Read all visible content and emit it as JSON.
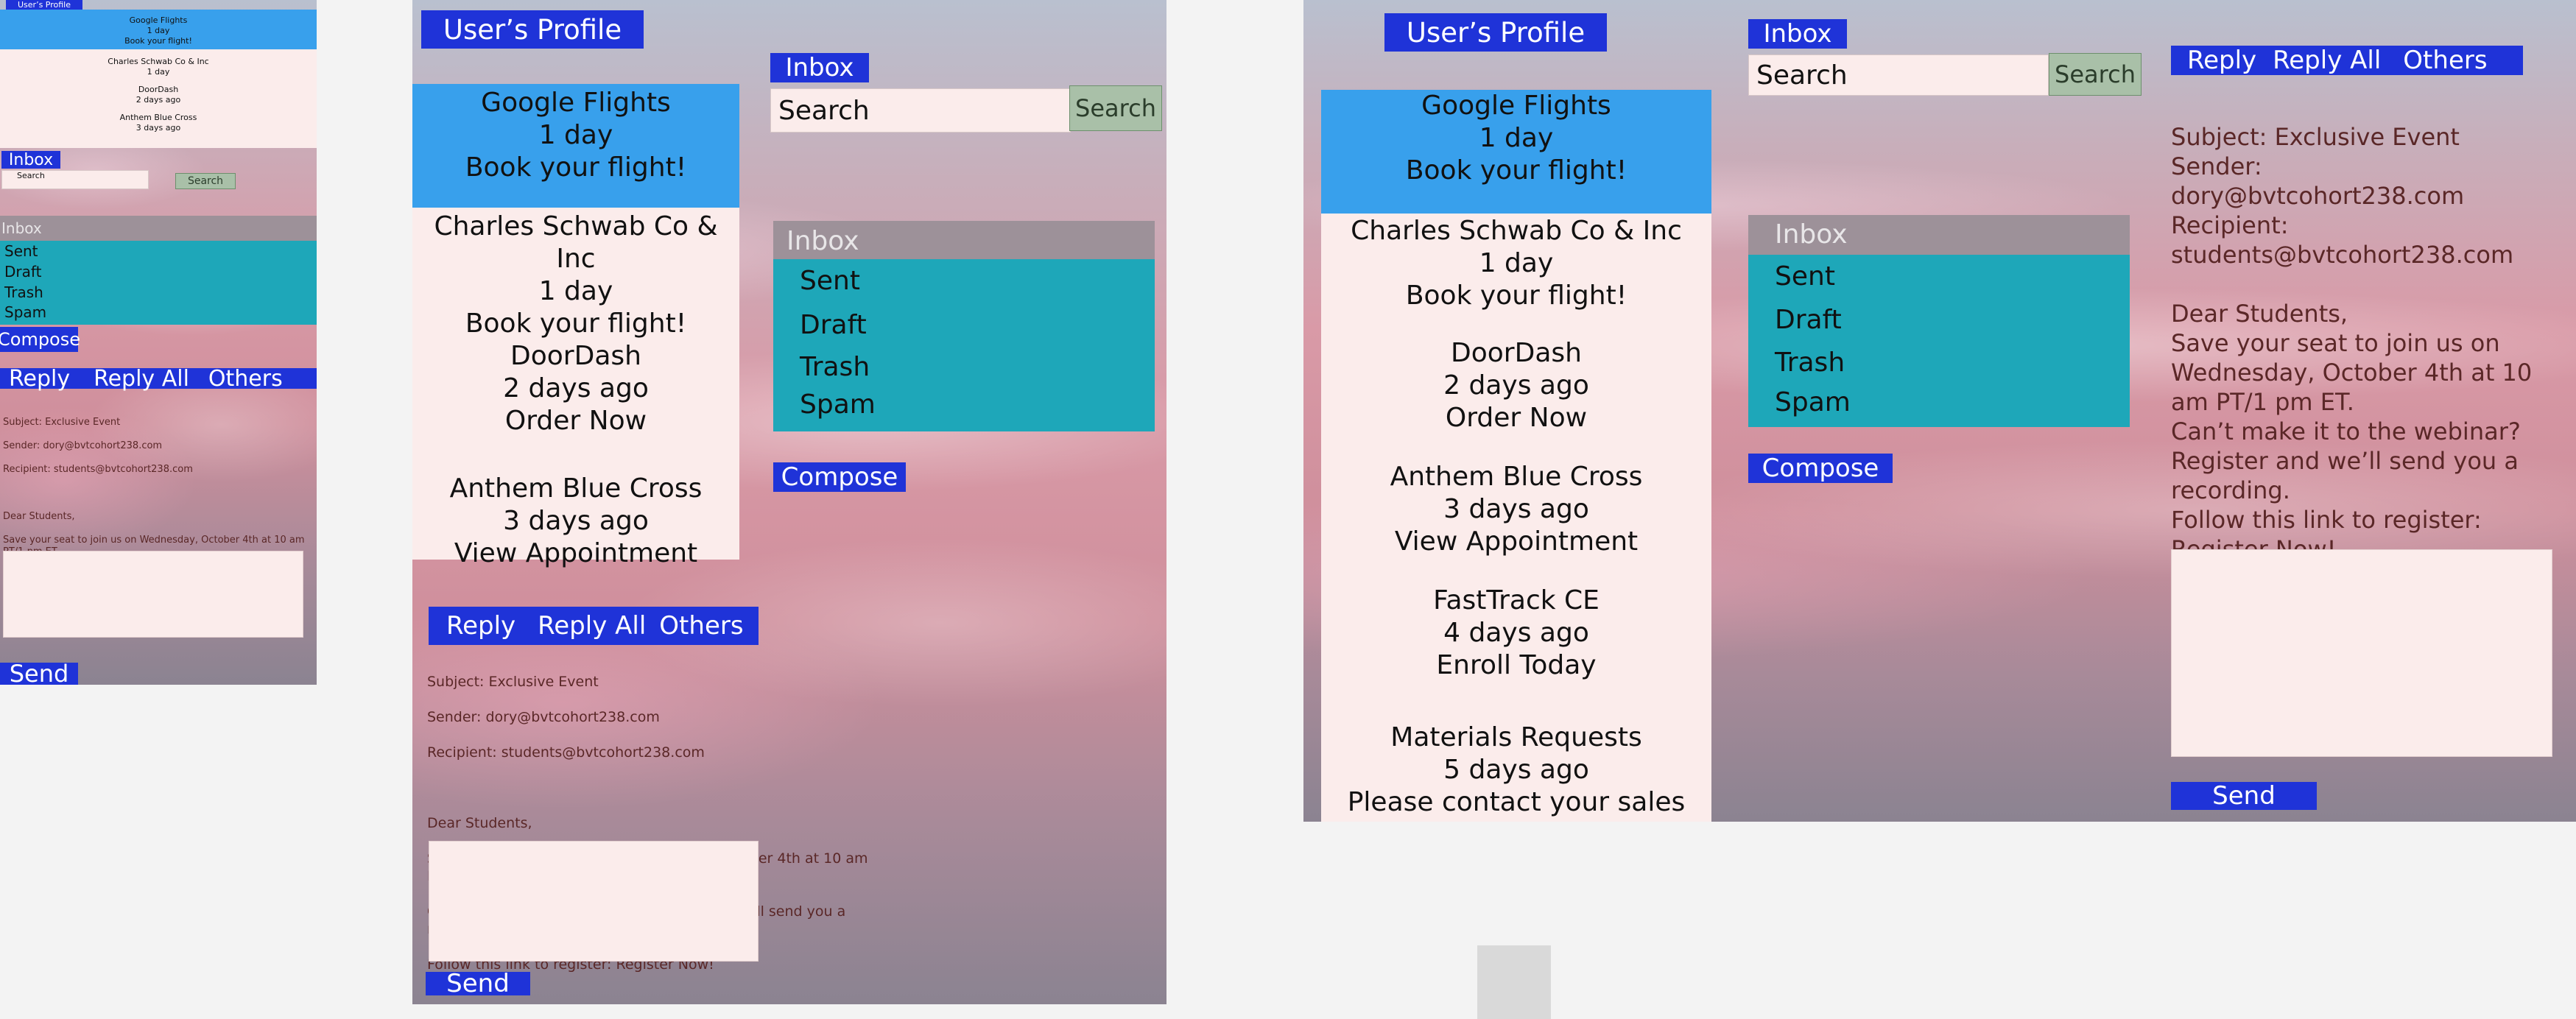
{
  "profile_label": "User’s Profile",
  "inbox_label": "Inbox",
  "search": {
    "placeholder": "Search",
    "button": "Search"
  },
  "emails": [
    {
      "sender": "Google Flights",
      "time": "1 day",
      "action": "Book your flight!"
    },
    {
      "sender": "Charles Schwab Co & Inc",
      "time": "1 day",
      "action": "Book your flight!"
    },
    {
      "sender": "DoorDash",
      "time": "2 days ago",
      "action": "Order Now"
    },
    {
      "sender": "Anthem Blue Cross",
      "time": "3 days ago",
      "action": "View Appointment"
    },
    {
      "sender": "FastTrack CE",
      "time": "4 days ago",
      "action": "Enroll Today"
    },
    {
      "sender": "Materials Requests",
      "time": "5 days ago",
      "action": "Please contact your sales"
    }
  ],
  "folders": [
    "Inbox",
    "Sent",
    "Draft",
    "Trash",
    "Spam"
  ],
  "compose_label": "Compose",
  "reply_actions": {
    "reply": "Reply",
    "reply_all": "Reply All",
    "others": "Others"
  },
  "message": {
    "subject": "Subject: Exclusive Event",
    "sender": "Sender: dory@bvtcohort238.com",
    "recipient": "Recipient: students@bvtcohort238.com",
    "recipient_label": "Recipient:",
    "recipient_email": "students@bvtcohort238.com",
    "greeting": "Dear Students,",
    "body1": "Save your seat to join us on Wednesday, October 4th at 10 am PT/1 pm ET.",
    "body2": "Can’t make it to the webinar? Register and we’ll send you a recording.",
    "body3": "Follow this link to register: Register Now!",
    "body3a": "Follow this link to register:",
    "body3b": "Register Now!"
  },
  "send_label": "Send"
}
